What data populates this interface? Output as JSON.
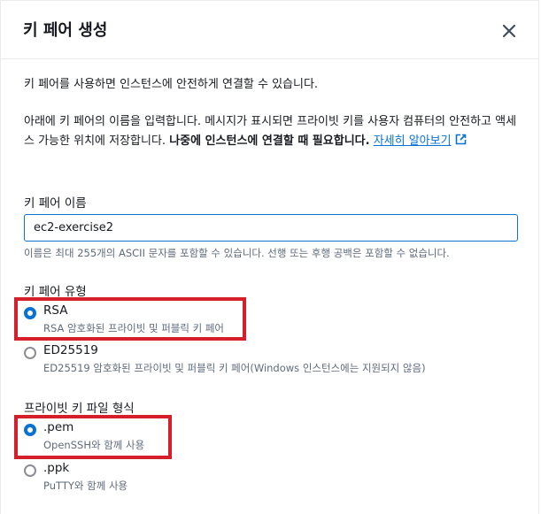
{
  "dialog": {
    "title": "키 페어 생성",
    "close_icon": "close-icon"
  },
  "intro": "키 페어를 사용하면 인스턴스에 안전하게 연결할 수 있습니다.",
  "instructions": {
    "text": "아래에 키 페어의 이름을 입력합니다. 메시지가 표시되면 프라이빗 키를 사용자 컴퓨터의 안전하고 액세스 가능한 위치에 저장합니다. ",
    "bold": "나중에 인스턴스에 연결할 때 필요합니다.",
    "link": "자세히 알아보기",
    "link_icon": "external-link-icon"
  },
  "key_name": {
    "label": "키 페어 이름",
    "value": "ec2-exercise2",
    "hint": "이름은 최대 255개의 ASCII 문자를 포함할 수 있습니다. 선행 또는 후행 공백은 포함할 수 없습니다."
  },
  "key_type": {
    "label": "키 페어 유형",
    "options": [
      {
        "label": "RSA",
        "desc": "RSA 암호화된 프라이빗 및 퍼블릭 키 페어",
        "checked": true
      },
      {
        "label": "ED25519",
        "desc": "ED25519 암호화된 프라이빗 및 퍼블릭 키 페어(Windows 인스턴스에는 지원되지 않음)",
        "checked": false
      }
    ]
  },
  "key_format": {
    "label": "프라이빗 키 파일 형식",
    "options": [
      {
        "label": ".pem",
        "desc": "OpenSSH와 함께 사용",
        "checked": true
      },
      {
        "label": ".ppk",
        "desc": "PuTTY와 함께 사용",
        "checked": false
      }
    ]
  },
  "colors": {
    "accent": "#0972d3",
    "highlight": "#d51f2a",
    "muted": "#5f6b7a"
  }
}
